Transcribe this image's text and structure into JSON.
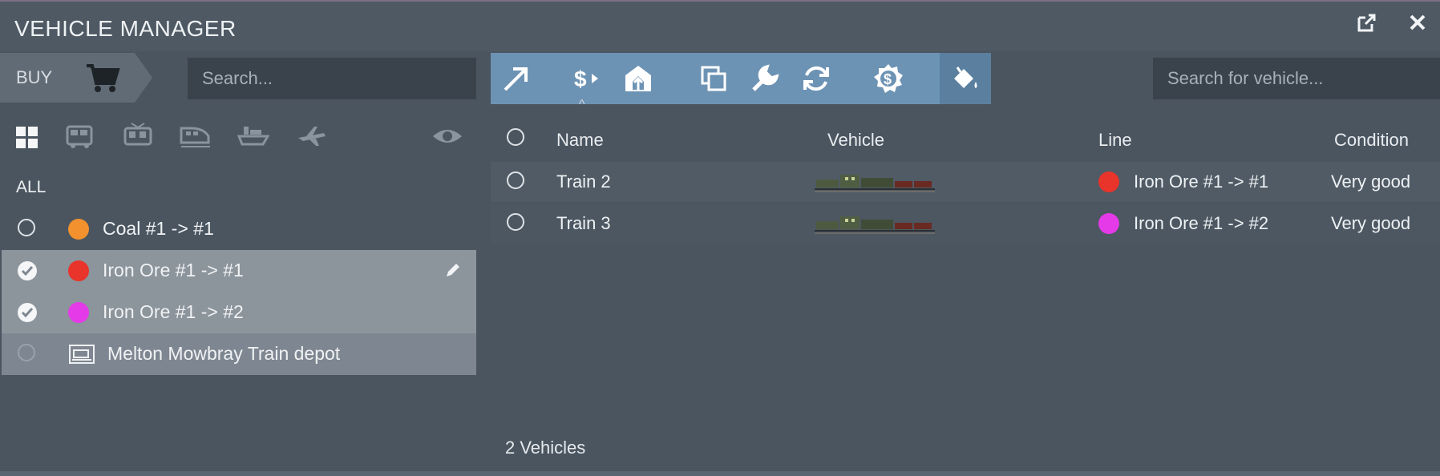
{
  "window": {
    "title": "VEHICLE MANAGER",
    "popout_icon": "external-link-icon",
    "close_icon": "close-icon"
  },
  "sidebar": {
    "buy_label": "BUY",
    "search_placeholder": "Search...",
    "filters": [
      "all-grid-icon",
      "bus-icon",
      "tram-icon",
      "train-icon",
      "ship-icon",
      "plane-icon",
      "visibility-eye-icon"
    ],
    "all_label": "ALL",
    "lines": [
      {
        "label": "Coal #1 -> #1",
        "color": "#f2912e",
        "selected": false
      },
      {
        "label": "Iron Ore #1 -> #1",
        "color": "#e8342a",
        "selected": true
      },
      {
        "label": "Iron Ore #1 -> #2",
        "color": "#e53ae8",
        "selected": true
      },
      {
        "label": "Melton Mowbray Train depot",
        "icon": "depot-icon",
        "selected": false
      }
    ]
  },
  "toolbar": {
    "buttons": [
      "send-arrow-icon",
      "sell-dollar-icon",
      "depot-return-icon",
      "replace-copy-icon",
      "repair-wrench-icon",
      "auto-replace-refresh-icon",
      "money-gear-icon",
      "paint-bucket-icon"
    ]
  },
  "vehicle_search": {
    "placeholder": "Search for vehicle..."
  },
  "table": {
    "columns": [
      "Name",
      "Vehicle",
      "Line",
      "Condition"
    ],
    "rows": [
      {
        "name": "Train 2",
        "line": "Iron Ore #1 -> #1",
        "line_color": "#e8342a",
        "condition": "Very good"
      },
      {
        "name": "Train 3",
        "line": "Iron Ore #1 -> #2",
        "line_color": "#e53ae8",
        "condition": "Very good"
      }
    ]
  },
  "footer": {
    "count": "2 Vehicles"
  }
}
